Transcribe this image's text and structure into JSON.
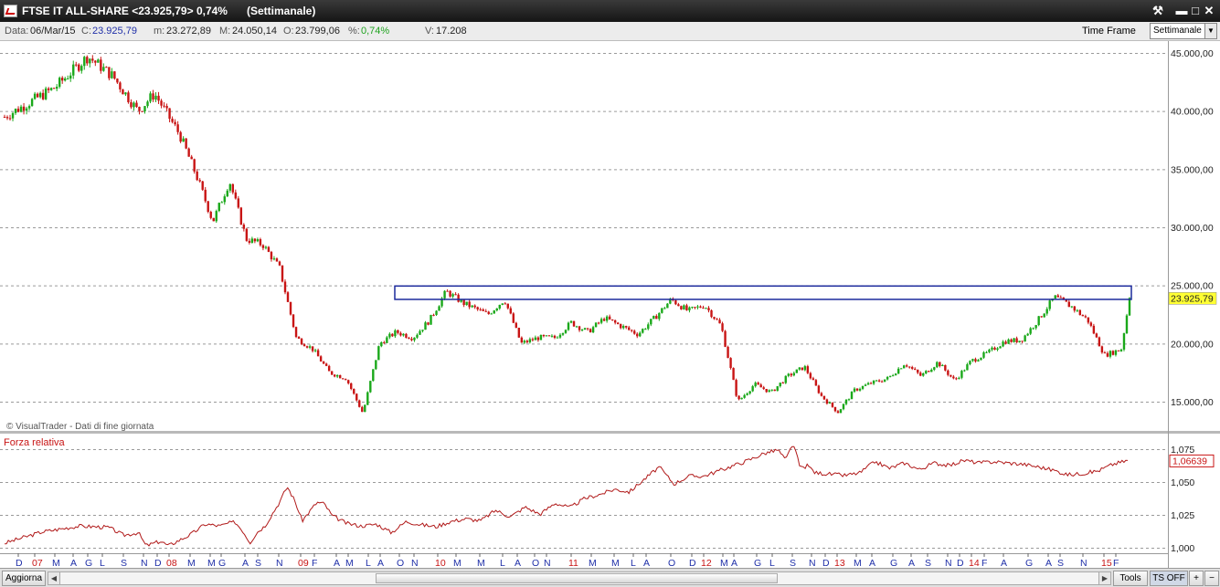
{
  "window": {
    "title": "FTSE IT ALL-SHARE <23.925,79> 0,74%",
    "subtitle": "(Settimanale)",
    "buttons": {
      "tool": "⚒",
      "minimize": "▬",
      "maximize": "□",
      "close": "✕"
    }
  },
  "infobar": {
    "data_label": "Data:",
    "data_value": "06/Mar/15",
    "c_label": "C:",
    "c_value": "23.925,79",
    "m_label": "m:",
    "m_value": "23.272,89",
    "M_label": "M:",
    "M_value": "24.050,14",
    "o_label": "O:",
    "o_value": "23.799,06",
    "pct_label": "%:",
    "pct_value": "0,74%",
    "v_label": "V:",
    "v_value": "17.208",
    "timeframe_label": "Time Frame",
    "timeframe_value": "Settimanale"
  },
  "chart_data": [
    {
      "type": "candlestick",
      "y_ticks": [
        "45.000,00",
        "40.000,00",
        "35.000,00",
        "30.000,00",
        "25.000,00",
        "20.000,00",
        "15.000,00"
      ],
      "ylim": [
        12000,
        47000
      ],
      "last_price_label": "23.925,79",
      "resistance_zone": [
        23800,
        24950
      ],
      "watermark": "© VisualTrader - Dati di fine giornata",
      "colors": {
        "up": "#1aa81a",
        "down": "#c81414",
        "zone": "#1c2a9c"
      },
      "path": [
        [
          0,
          39500
        ],
        [
          6,
          42000
        ],
        [
          10,
          44700
        ],
        [
          13,
          43000
        ],
        [
          16,
          40000
        ],
        [
          18,
          41500
        ],
        [
          21,
          38000
        ],
        [
          23,
          34500
        ],
        [
          25,
          30500
        ],
        [
          27,
          34000
        ],
        [
          29,
          29000
        ],
        [
          31,
          28500
        ],
        [
          33,
          26500
        ],
        [
          35,
          20500
        ],
        [
          37,
          19500
        ],
        [
          39,
          17500
        ],
        [
          41,
          17000
        ],
        [
          43,
          14000
        ],
        [
          45,
          20000
        ],
        [
          47,
          21000
        ],
        [
          49,
          20500
        ],
        [
          51,
          22000
        ],
        [
          53,
          24500
        ],
        [
          55,
          23500
        ],
        [
          58,
          22500
        ],
        [
          60,
          23800
        ],
        [
          62,
          20000
        ],
        [
          64,
          20500
        ],
        [
          66,
          20500
        ],
        [
          68,
          21800
        ],
        [
          70,
          21000
        ],
        [
          72,
          22200
        ],
        [
          74,
          21500
        ],
        [
          76,
          20800
        ],
        [
          78,
          22200
        ],
        [
          80,
          23800
        ],
        [
          82,
          22800
        ],
        [
          84,
          23300
        ],
        [
          86,
          21500
        ],
        [
          88,
          15000
        ],
        [
          90,
          16500
        ],
        [
          92,
          15800
        ],
        [
          94,
          17200
        ],
        [
          96,
          18000
        ],
        [
          98,
          15500
        ],
        [
          100,
          14100
        ],
        [
          102,
          16000
        ],
        [
          104,
          16600
        ],
        [
          106,
          17000
        ],
        [
          108,
          18300
        ],
        [
          110,
          17200
        ],
        [
          112,
          18400
        ],
        [
          114,
          16800
        ],
        [
          116,
          18500
        ],
        [
          118,
          19200
        ],
        [
          120,
          20200
        ],
        [
          122,
          20300
        ],
        [
          124,
          22000
        ],
        [
          126,
          24000
        ],
        [
          128,
          23200
        ],
        [
          130,
          22000
        ],
        [
          132,
          19000
        ],
        [
          134,
          19500
        ],
        [
          135,
          23925
        ]
      ],
      "x_ticks": [
        {
          "label": "D",
          "year": false
        },
        {
          "label": "07",
          "year": true
        },
        {
          "label": "M",
          "year": false
        },
        {
          "label": "A",
          "year": false
        },
        {
          "label": "G",
          "year": false
        },
        {
          "label": "L",
          "year": false
        },
        {
          "label": "S",
          "year": false
        },
        {
          "label": "N",
          "year": false
        },
        {
          "label": "D",
          "year": false
        },
        {
          "label": "08",
          "year": true
        },
        {
          "label": "M",
          "year": false
        },
        {
          "label": "M",
          "year": false
        },
        {
          "label": "G",
          "year": false
        },
        {
          "label": "A",
          "year": false
        },
        {
          "label": "S",
          "year": false
        },
        {
          "label": "N",
          "year": false
        },
        {
          "label": "09",
          "year": true
        },
        {
          "label": "F",
          "year": false
        },
        {
          "label": "A",
          "year": false
        },
        {
          "label": "M",
          "year": false
        },
        {
          "label": "L",
          "year": false
        },
        {
          "label": "A",
          "year": false
        },
        {
          "label": "O",
          "year": false
        },
        {
          "label": "N",
          "year": false
        },
        {
          "label": "10",
          "year": true
        },
        {
          "label": "M",
          "year": false
        },
        {
          "label": "M",
          "year": false
        },
        {
          "label": "L",
          "year": false
        },
        {
          "label": "A",
          "year": false
        },
        {
          "label": "O",
          "year": false
        },
        {
          "label": "N",
          "year": false
        },
        {
          "label": "11",
          "year": true
        },
        {
          "label": "M",
          "year": false
        },
        {
          "label": "M",
          "year": false
        },
        {
          "label": "L",
          "year": false
        },
        {
          "label": "A",
          "year": false
        },
        {
          "label": "O",
          "year": false
        },
        {
          "label": "D",
          "year": false
        },
        {
          "label": "12",
          "year": true
        },
        {
          "label": "M",
          "year": false
        },
        {
          "label": "A",
          "year": false
        },
        {
          "label": "G",
          "year": false
        },
        {
          "label": "L",
          "year": false
        },
        {
          "label": "S",
          "year": false
        },
        {
          "label": "N",
          "year": false
        },
        {
          "label": "D",
          "year": false
        },
        {
          "label": "13",
          "year": true
        },
        {
          "label": "M",
          "year": false
        },
        {
          "label": "A",
          "year": false
        },
        {
          "label": "G",
          "year": false
        },
        {
          "label": "A",
          "year": false
        },
        {
          "label": "S",
          "year": false
        },
        {
          "label": "N",
          "year": false
        },
        {
          "label": "D",
          "year": false
        },
        {
          "label": "14",
          "year": true
        },
        {
          "label": "F",
          "year": false
        },
        {
          "label": "A",
          "year": false
        },
        {
          "label": "G",
          "year": false
        },
        {
          "label": "A",
          "year": false
        },
        {
          "label": "S",
          "year": false
        },
        {
          "label": "N",
          "year": false
        },
        {
          "label": "15",
          "year": true
        },
        {
          "label": "F",
          "year": false
        }
      ],
      "x_tick_slots": [
        20,
        38,
        60,
        80,
        96,
        112,
        135,
        157,
        172,
        185,
        208,
        230,
        242,
        268,
        282,
        305,
        329,
        344,
        368,
        381,
        403,
        416,
        437,
        453,
        479,
        499,
        525,
        550,
        566,
        585,
        598,
        625,
        647,
        672,
        693,
        707,
        734,
        757,
        770,
        791,
        803,
        828,
        845,
        867,
        888,
        903,
        916,
        937,
        954,
        977,
        997,
        1015,
        1037,
        1050,
        1063,
        1077,
        1098,
        1125,
        1147,
        1160,
        1185,
        1208,
        1221
      ]
    },
    {
      "type": "line",
      "title": "Forza relativa",
      "y_ticks": [
        "1,075",
        "1,050",
        "1,025",
        "1,000"
      ],
      "ylim": [
        0.9985,
        1.0795
      ],
      "last_value_label": "1,06639",
      "color": "#b01818",
      "path": [
        [
          0,
          1.0035
        ],
        [
          5,
          1.012
        ],
        [
          10,
          1.0165
        ],
        [
          14,
          1.0155
        ],
        [
          16,
          1.0095
        ],
        [
          18,
          1.0115
        ],
        [
          19,
          1.0015
        ],
        [
          21,
          1.005
        ],
        [
          22,
          1.0015
        ],
        [
          25,
          1.01
        ],
        [
          27,
          1.018
        ],
        [
          29,
          1.0165
        ],
        [
          30,
          1.0185
        ],
        [
          31,
          1.0195
        ],
        [
          32,
          1.013
        ],
        [
          33,
          1.004
        ],
        [
          34,
          1.012
        ],
        [
          35,
          1.0165
        ],
        [
          37,
          1.035
        ],
        [
          38,
          1.0465
        ],
        [
          39,
          1.036
        ],
        [
          40,
          1.0205
        ],
        [
          42,
          1.0345
        ],
        [
          43,
          1.0335
        ],
        [
          44,
          1.0245
        ],
        [
          46,
          1.0185
        ],
        [
          48,
          1.0165
        ],
        [
          50,
          1.018
        ],
        [
          52,
          1.0115
        ],
        [
          54,
          1.02
        ],
        [
          56,
          1.0175
        ],
        [
          58,
          1.016
        ],
        [
          60,
          1.02
        ],
        [
          62,
          1.022
        ],
        [
          64,
          1.0205
        ],
        [
          66,
          1.0285
        ],
        [
          68,
          1.0235
        ],
        [
          70,
          1.031
        ],
        [
          72,
          1.0255
        ],
        [
          74,
          1.034
        ],
        [
          76,
          1.0305
        ],
        [
          78,
          1.0375
        ],
        [
          80,
          1.0405
        ],
        [
          82,
          1.0445
        ],
        [
          84,
          1.0425
        ],
        [
          86,
          1.052
        ],
        [
          88,
          1.0615
        ],
        [
          90,
          1.0485
        ],
        [
          92,
          1.0545
        ],
        [
          94,
          1.0545
        ],
        [
          96,
          1.0585
        ],
        [
          98,
          1.0625
        ],
        [
          100,
          1.0665
        ],
        [
          102,
          1.0715
        ],
        [
          104,
          1.0745
        ],
        [
          105,
          1.0665
        ],
        [
          106,
          1.0795
        ],
        [
          107,
          1.0605
        ],
        [
          108,
          1.0625
        ],
        [
          109,
          1.057
        ],
        [
          111,
          1.056
        ],
        [
          113,
          1.055
        ],
        [
          115,
          1.057
        ],
        [
          117,
          1.0655
        ],
        [
          119,
          1.0605
        ],
        [
          121,
          1.0645
        ],
        [
          123,
          1.0595
        ],
        [
          125,
          1.0645
        ],
        [
          127,
          1.0625
        ],
        [
          129,
          1.0665
        ],
        [
          131,
          1.0645
        ],
        [
          133,
          1.0655
        ],
        [
          135,
          1.0645
        ],
        [
          137,
          1.0635
        ],
        [
          139,
          1.0615
        ],
        [
          141,
          1.059
        ],
        [
          143,
          1.0555
        ],
        [
          145,
          1.0565
        ],
        [
          147,
          1.0585
        ],
        [
          149,
          1.0635
        ],
        [
          151,
          1.0664
        ]
      ]
    }
  ],
  "statusbar": {
    "refresh": "Aggiorna",
    "tools": "Tools",
    "ts_off": "TS OFF",
    "plus": "+",
    "minus": "−"
  }
}
